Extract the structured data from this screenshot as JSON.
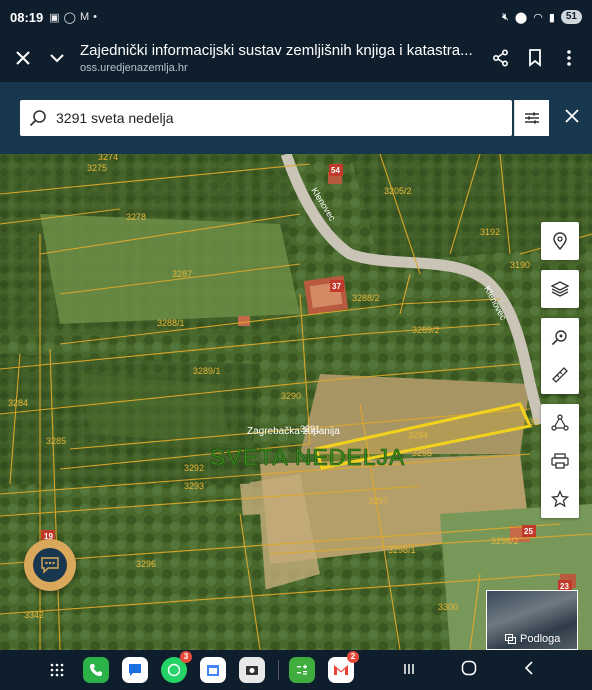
{
  "status": {
    "time": "08:19",
    "left_icons": [
      "screenshot-icon",
      "whatsapp-icon",
      "gmail-icon",
      "dot-icon"
    ],
    "battery": "51"
  },
  "browser": {
    "title": "Zajednički informacijski sustav zemljišnih knjiga i katastra...",
    "url": "oss.uredjenazemlja.hr"
  },
  "search": {
    "value": "3291 sveta nedelja"
  },
  "map": {
    "street_label": "Klenovec",
    "county_label": "Zagrebačka županija",
    "municipality_label": "SVETA NEDELJA",
    "house_numbers": [
      "54",
      "37",
      "19",
      "25",
      "23"
    ],
    "parcel_labels": [
      "3274",
      "3275",
      "3278",
      "3287",
      "3288/1",
      "3288/2",
      "3289/1",
      "3289/2",
      "3290",
      "3291",
      "3292",
      "3293",
      "3294",
      "3295",
      "3296",
      "3297",
      "3298/1",
      "3298/2",
      "3300",
      "3342",
      "3284",
      "3285",
      "3205/2",
      "3192",
      "3190",
      "32"
    ],
    "selected_parcel": "3291",
    "basemap_label": "Podloga"
  },
  "nav": {
    "apps": [
      {
        "name": "apps-grid",
        "badge": ""
      },
      {
        "name": "phone",
        "badge": ""
      },
      {
        "name": "messages",
        "badge": ""
      },
      {
        "name": "whatsapp",
        "badge": "3"
      },
      {
        "name": "calendar",
        "badge": ""
      },
      {
        "name": "camera",
        "badge": ""
      },
      {
        "name": "calculator",
        "badge": ""
      },
      {
        "name": "gmail",
        "badge": "2"
      }
    ]
  }
}
